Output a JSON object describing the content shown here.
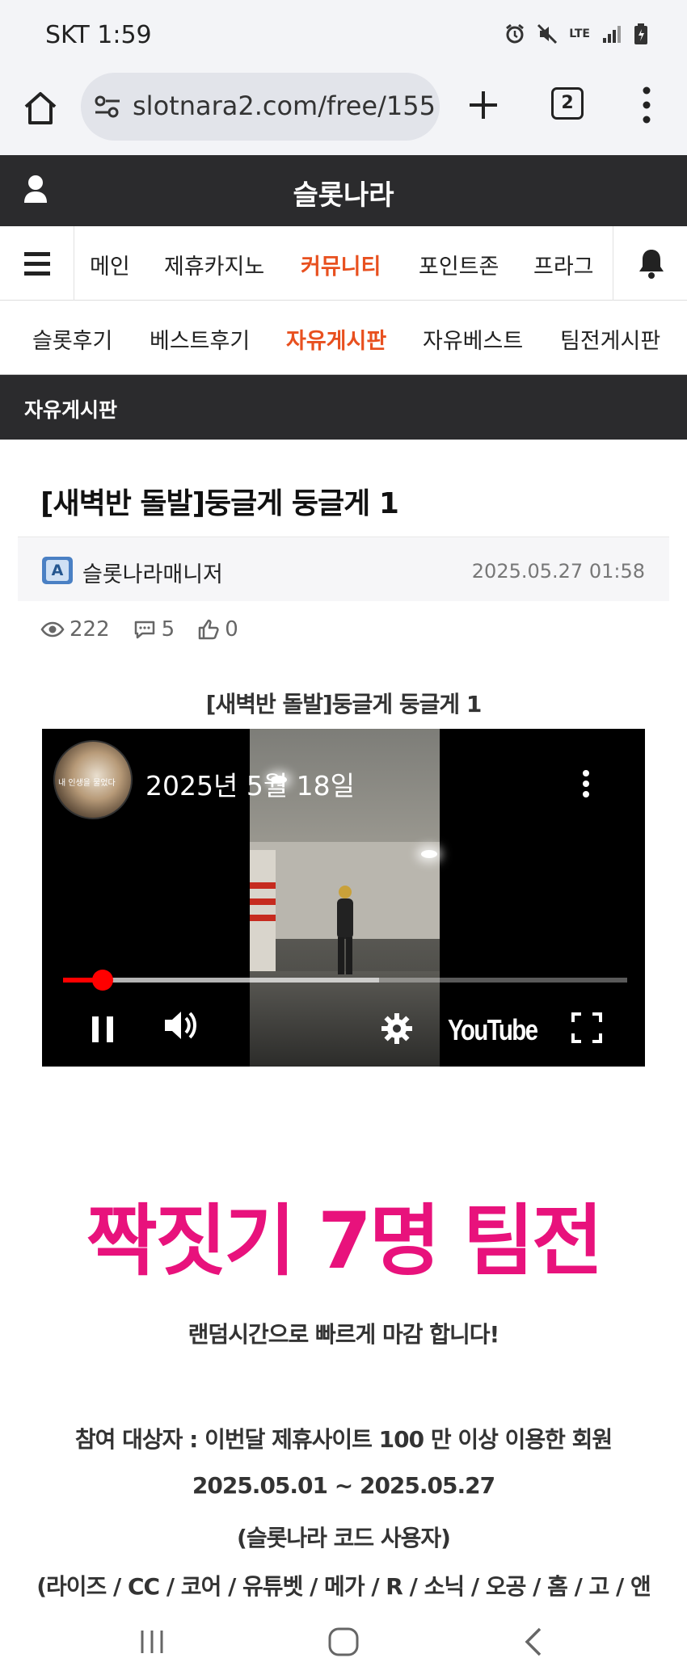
{
  "status_bar": {
    "time": "SKT 1:59",
    "lte": "LTE"
  },
  "browser": {
    "url": "slotnara2.com/free/155",
    "tab_count": "2"
  },
  "site": {
    "title": "슬롯나라"
  },
  "main_nav": {
    "items": [
      "메인",
      "제휴카지노",
      "커뮤니티",
      "포인트존",
      "프라그"
    ],
    "active_index": 2
  },
  "sub_nav": {
    "items": [
      "슬롯후기",
      "베스트후기",
      "자유게시판",
      "자유베스트",
      "팀전게시판"
    ],
    "active_index": 2
  },
  "board": {
    "title": "자유게시판"
  },
  "post": {
    "title": "[새벽반 돌발]둥글게 둥글게 1",
    "author_badge": "A",
    "author": "슬롯나라매니저",
    "date": "2025.05.27 01:58",
    "views": "222",
    "comments": "5",
    "likes": "0",
    "content_title": "[새벽반 돌발]둥글게 둥글게 1"
  },
  "video": {
    "title": "2025년 5월 18일",
    "channel_caption": "내 인생을 물었다",
    "brand": "YouTube",
    "progress_fraction": 0.07,
    "buffer_fraction": 0.56
  },
  "promo": {
    "headline": "짝짓기 7명 팀전",
    "subline": "랜덤시간으로 빠르게 마감 합니다!",
    "eligibility": "참여 대상자 : 이번달 제휴사이트 100 만 이상 이용한 회원",
    "period": "2025.05.01 ~ 2025.05.27",
    "code_note": "(슬롯나라 코드 사용자)",
    "sites": "(라이즈 / CC / 코어 / 유튜벳 / 메가 / R / 소닉 / 오공 / 홈 / 고 / 앤"
  },
  "colors": {
    "accent": "#e8501f",
    "promo": "#e8127c",
    "header": "#2b2b2d"
  },
  "icons": [
    "home-icon",
    "tune-icon",
    "plus-icon",
    "tabs-icon",
    "kebab-icon",
    "user-icon",
    "menu-icon",
    "bell-icon",
    "eye-icon",
    "comment-icon",
    "thumbs-up-icon",
    "pause-icon",
    "volume-icon",
    "settings-icon",
    "fullscreen-icon"
  ]
}
